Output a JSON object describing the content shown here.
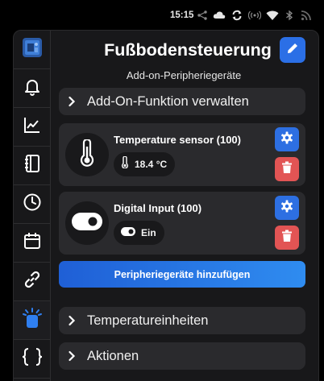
{
  "status_bar": {
    "time": "15:15",
    "icons": [
      "share-icon",
      "cloud-icon",
      "sync-icon",
      "hotspot-icon",
      "wifi-icon",
      "bluetooth-icon",
      "rss-icon"
    ]
  },
  "sidebar": {
    "items": [
      {
        "name": "app-logo",
        "icon": "logo-icon"
      },
      {
        "name": "notifications",
        "icon": "bell-icon"
      },
      {
        "name": "charts",
        "icon": "chart-line-icon"
      },
      {
        "name": "notebook",
        "icon": "notebook-icon"
      },
      {
        "name": "schedule",
        "icon": "clock-icon"
      },
      {
        "name": "calendar",
        "icon": "calendar-icon"
      },
      {
        "name": "links",
        "icon": "link-icon"
      },
      {
        "name": "peripherals",
        "icon": "peripheral-icon",
        "active": true
      },
      {
        "name": "code",
        "icon": "braces-icon"
      }
    ]
  },
  "page": {
    "title": "Fußbodensteuerung",
    "subtitle": "Add-on-Peripheriegeräte"
  },
  "sections": {
    "manage": "Add-On-Funktion verwalten",
    "temperature_units": "Temperatureinheiten",
    "actions": "Aktionen"
  },
  "devices": [
    {
      "name": "Temperature sensor (100)",
      "value": "18.4 °C",
      "icon": "thermometer-icon"
    },
    {
      "name": "Digital Input (100)",
      "value": "Ein",
      "icon": "toggle-icon"
    }
  ],
  "add_button": "Peripheriegeräte hinzufügen",
  "colors": {
    "accent_blue": "#2b6fe6",
    "delete_red": "#e25454",
    "card_bg": "#2a2a2d",
    "app_bg": "#18181a"
  }
}
